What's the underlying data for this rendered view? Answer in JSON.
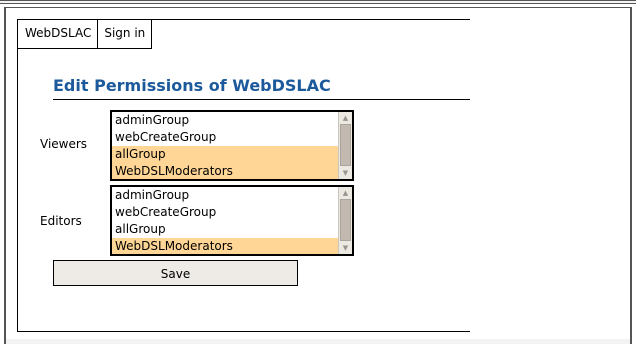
{
  "menu": {
    "items": [
      {
        "label": "WebDSLAC"
      },
      {
        "label": "Sign in"
      }
    ]
  },
  "page": {
    "title": "Edit Permissions of WebDSLAC"
  },
  "viewers": {
    "label": "Viewers",
    "options": [
      {
        "label": "adminGroup",
        "selected": false
      },
      {
        "label": "webCreateGroup",
        "selected": false
      },
      {
        "label": "allGroup",
        "selected": true
      },
      {
        "label": "WebDSLModerators",
        "selected": true
      }
    ]
  },
  "editors": {
    "label": "Editors",
    "options": [
      {
        "label": "adminGroup",
        "selected": false
      },
      {
        "label": "webCreateGroup",
        "selected": false
      },
      {
        "label": "allGroup",
        "selected": false
      },
      {
        "label": "WebDSLModerators",
        "selected": true
      }
    ]
  },
  "actions": {
    "save_label": "Save"
  },
  "colors": {
    "title": "#1d5a9c",
    "selected_option": "#ffd695",
    "button_bg": "#eeebe6"
  },
  "icons": {
    "scroll_up": "scroll-up-arrow-icon",
    "scroll_down": "scroll-down-arrow-icon"
  }
}
